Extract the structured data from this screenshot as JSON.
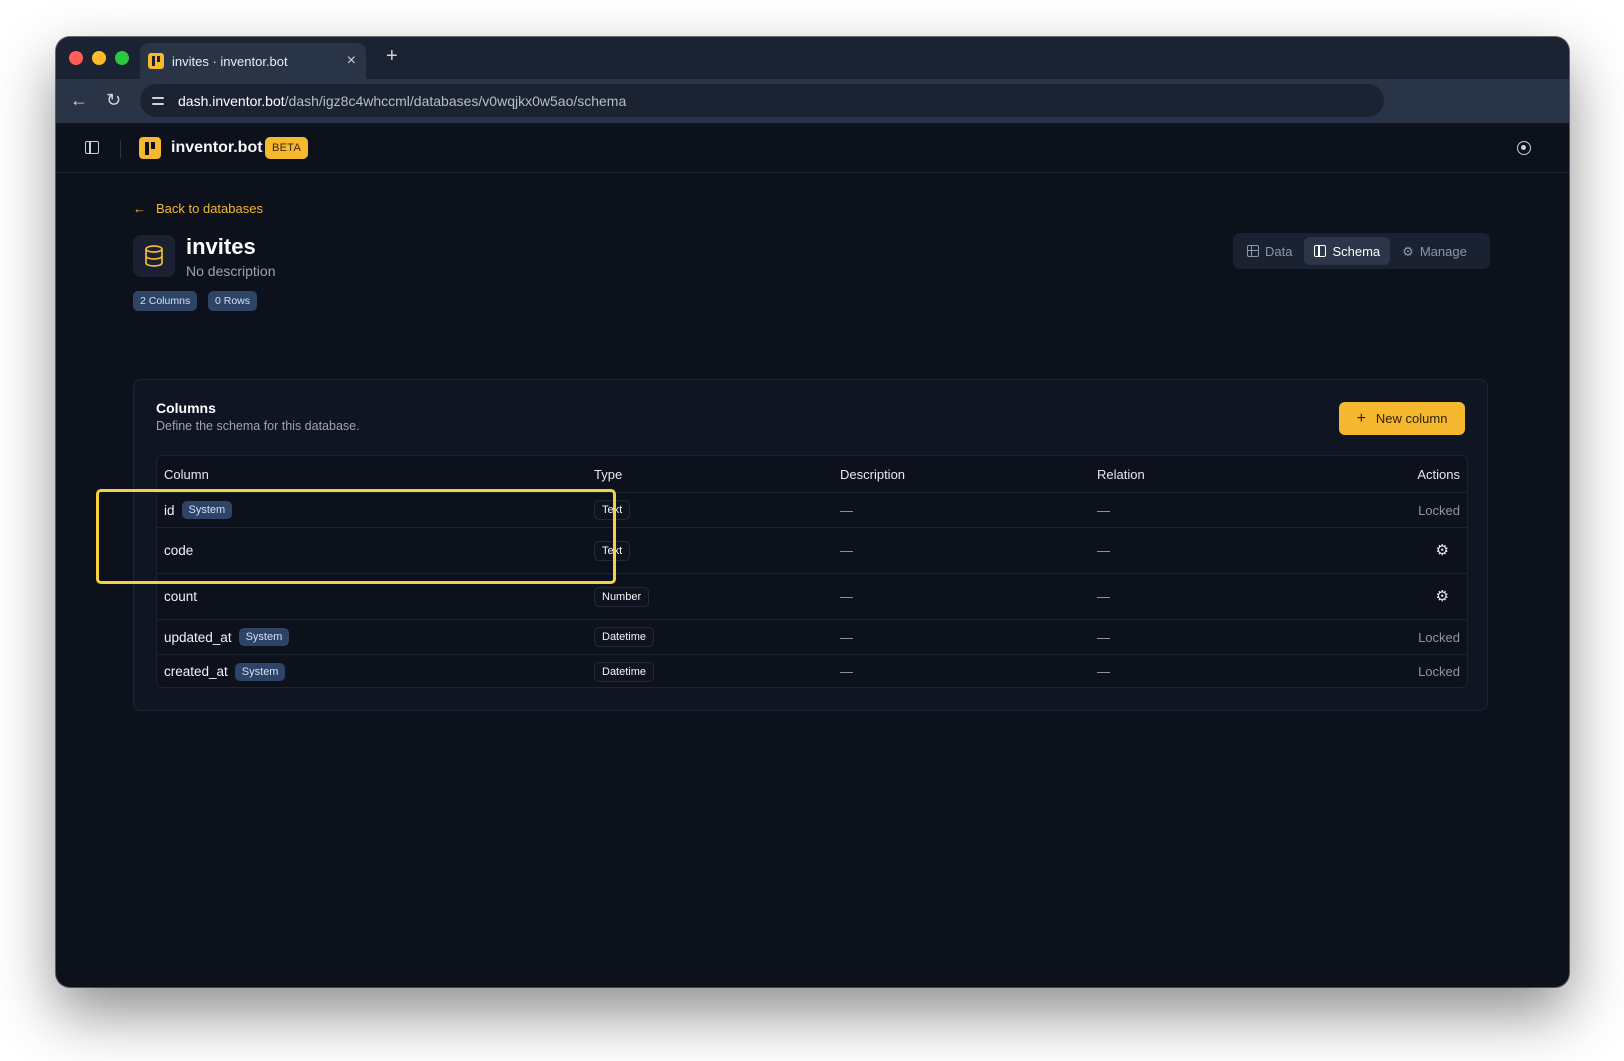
{
  "browser": {
    "tab_title": "invites · inventor.bot",
    "tab_close": "×",
    "new_tab": "+",
    "back": "←",
    "reload": "↻",
    "url_host": "dash.inventor.bot",
    "url_path": "/dash/igz8c4whccml/databases/v0wqjkx0w5ao/schema"
  },
  "app": {
    "brand": "inventor.bot",
    "beta_label": "BETA"
  },
  "page": {
    "back_arrow": "←",
    "back_label": "Back to databases",
    "title": "invites",
    "description": "No description",
    "columns_pill": "2 Columns",
    "rows_pill": "0 Rows",
    "views": [
      {
        "label": "Data",
        "active": false
      },
      {
        "label": "Schema",
        "active": true
      },
      {
        "label": "Manage",
        "active": false
      }
    ]
  },
  "card": {
    "title": "Columns",
    "subtitle": "Define the schema for this database.",
    "new_column_plus": "+",
    "new_column_label": "New column"
  },
  "table": {
    "headers": {
      "column": "Column",
      "type": "Type",
      "description": "Description",
      "relation": "Relation",
      "actions": "Actions"
    },
    "rows": [
      {
        "name": "id",
        "badge": "System",
        "type": "Text",
        "description": "—",
        "relation": "—",
        "action": "Locked"
      },
      {
        "name": "code",
        "badge": "",
        "type": "Text",
        "description": "—",
        "relation": "—",
        "action": "⚙"
      },
      {
        "name": "count",
        "badge": "",
        "type": "Number",
        "description": "—",
        "relation": "—",
        "action": "⚙"
      },
      {
        "name": "updated_at",
        "badge": "System",
        "type": "Datetime",
        "description": "—",
        "relation": "—",
        "action": "Locked"
      },
      {
        "name": "created_at",
        "badge": "System",
        "type": "Datetime",
        "description": "—",
        "relation": "—",
        "action": "Locked"
      }
    ]
  },
  "colors": {
    "accent": "#f5b82e",
    "highlight": "#f5d33d",
    "background": "#0c111b",
    "badge": "#2d4466"
  },
  "icons": {
    "sidebar_toggle": "sidebar-toggle-icon",
    "profile": "target-icon",
    "database": "database-icon",
    "data_view": "table-icon",
    "schema_view": "columns-icon",
    "manage_view": "gear-icon",
    "row_action": "gear-icon"
  }
}
